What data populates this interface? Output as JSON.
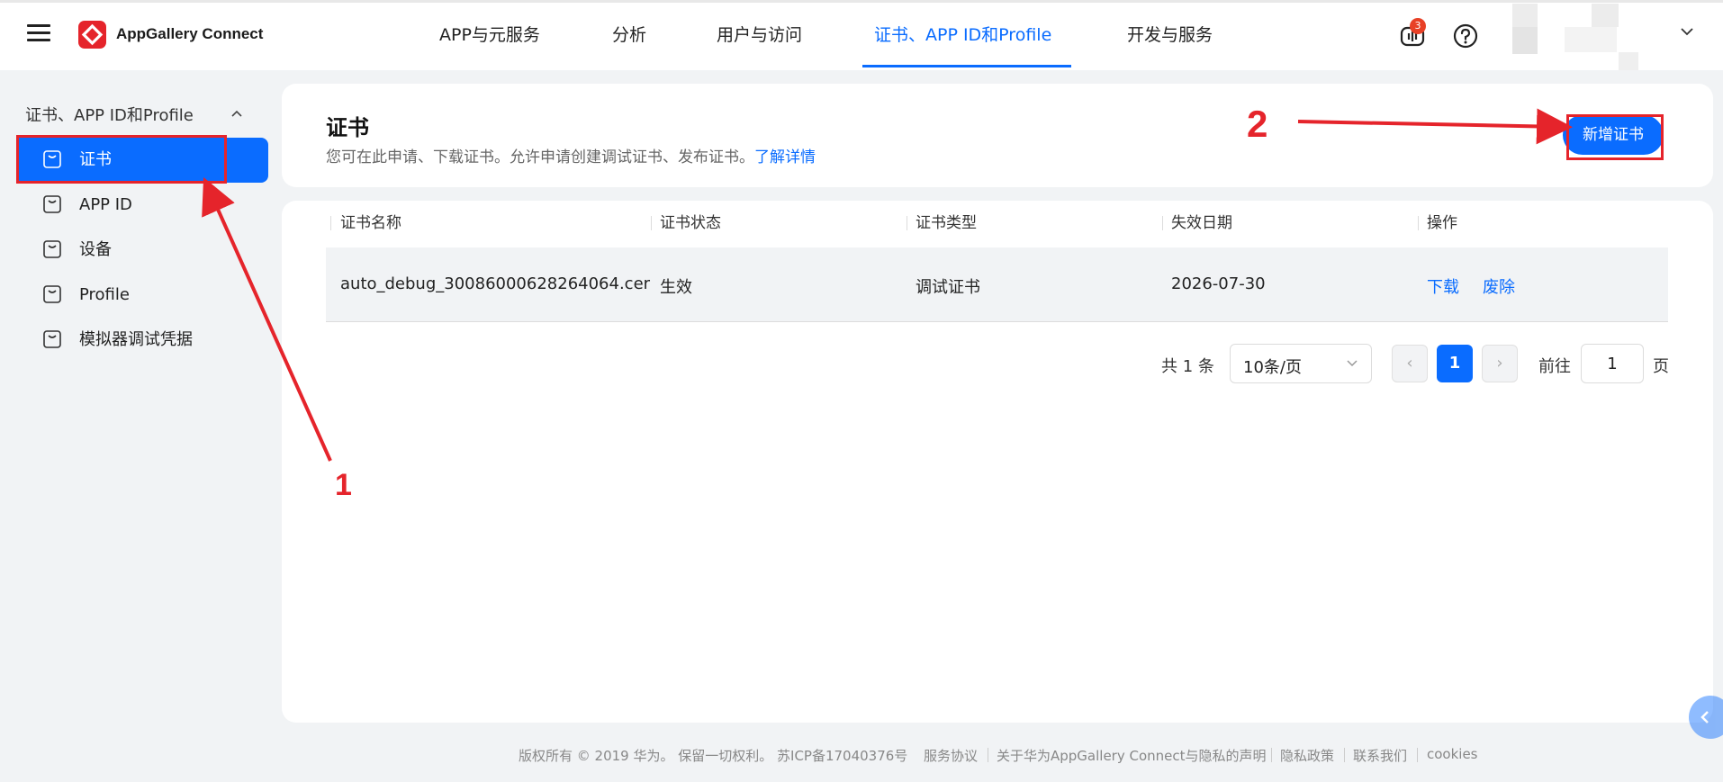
{
  "header": {
    "brand": "AppGallery Connect",
    "nav": [
      {
        "label": "APP与元服务",
        "active": false
      },
      {
        "label": "分析",
        "active": false
      },
      {
        "label": "用户与访问",
        "active": false
      },
      {
        "label": "证书、APP ID和Profile",
        "active": true
      },
      {
        "label": "开发与服务",
        "active": false
      }
    ],
    "notification_count": "3",
    "icons": [
      "menu-icon",
      "appgallery-logo",
      "notification-icon",
      "help-icon",
      "chevron-down-icon"
    ]
  },
  "sidebar": {
    "group_title": "证书、APP ID和Profile",
    "items": [
      {
        "label": "证书",
        "active": true
      },
      {
        "label": "APP ID",
        "active": false
      },
      {
        "label": "设备",
        "active": false
      },
      {
        "label": "Profile",
        "active": false
      },
      {
        "label": "模拟器调试凭据",
        "active": false
      }
    ]
  },
  "main": {
    "title": "证书",
    "description": "您可在此申请、下载证书。允许申请创建调试证书、发布证书。",
    "learn_more": "了解详情",
    "add_button": "新增证书",
    "table": {
      "columns": [
        "证书名称",
        "证书状态",
        "证书类型",
        "失效日期",
        "操作"
      ],
      "rows": [
        {
          "name": "auto_debug_30086000628264064.cer",
          "status": "生效",
          "type": "调试证书",
          "expiry": "2026-07-30",
          "actions": [
            "下载",
            "废除"
          ]
        }
      ]
    },
    "pagination": {
      "total": "共 1 条",
      "page_size": "10条/页",
      "prev": "‹",
      "current": "1",
      "next": "›",
      "goto_label": "前往",
      "goto_value": "1",
      "page_suffix": "页"
    }
  },
  "footer": {
    "copyright": "版权所有 © 2019 华为。 保留一切权利。 苏ICP备17040376号",
    "links": [
      "服务协议",
      "关于华为AppGallery Connect与隐私的声明",
      "隐私政策",
      "联系我们",
      "cookies"
    ]
  },
  "annotations": {
    "step1": "1",
    "step2": "2",
    "color": "#e5242b"
  },
  "colors": {
    "accent": "#0a6cff",
    "background": "#f1f3f5",
    "badge": "#e84026"
  }
}
